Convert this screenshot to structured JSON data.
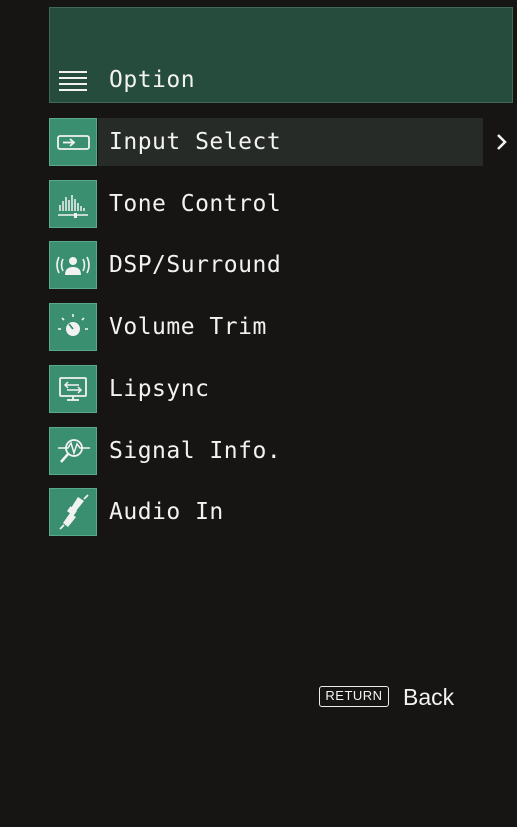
{
  "header": {
    "title": "Option",
    "icon": "menu-lines-icon"
  },
  "menu": {
    "selected_index": 0,
    "items": [
      {
        "label": "Input Select",
        "icon": "input-select-icon"
      },
      {
        "label": "Tone Control",
        "icon": "tone-control-icon"
      },
      {
        "label": "DSP/Surround",
        "icon": "dsp-surround-icon"
      },
      {
        "label": "Volume Trim",
        "icon": "volume-trim-icon"
      },
      {
        "label": "Lipsync",
        "icon": "lipsync-icon"
      },
      {
        "label": "Signal Info.",
        "icon": "signal-info-icon"
      },
      {
        "label": "Audio In",
        "icon": "audio-in-icon"
      }
    ]
  },
  "footer": {
    "return_key": "RETURN",
    "back_label": "Back"
  },
  "colors": {
    "background": "#161513",
    "header_bg": "#264c3d",
    "icon_bg": "#3a8f71",
    "selected_row_bg": "#262b27",
    "text": "#f2f2f2"
  }
}
